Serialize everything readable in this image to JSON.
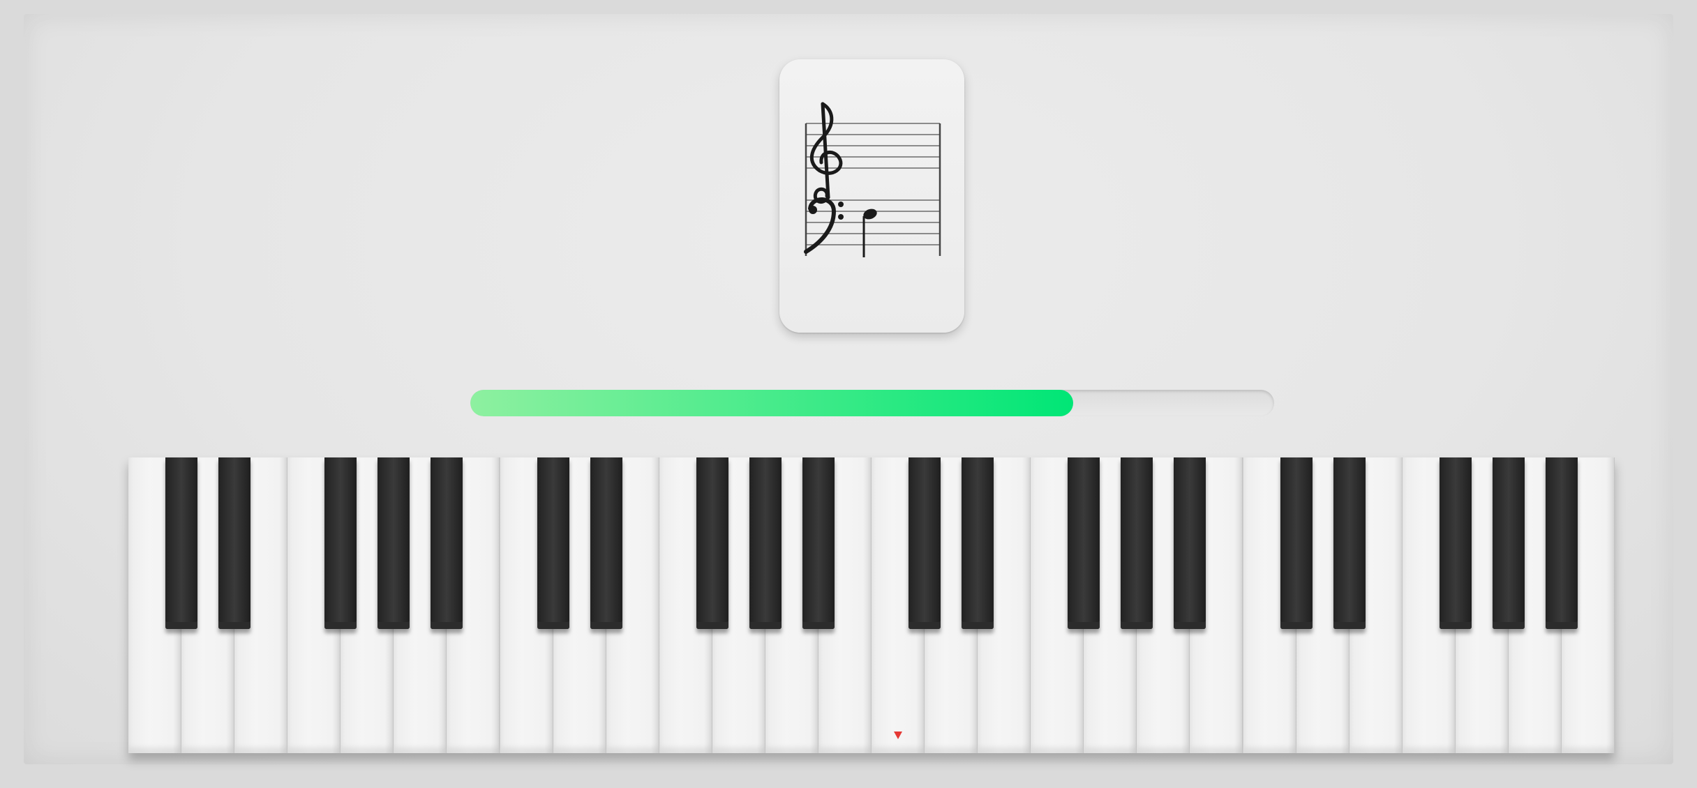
{
  "sheet_card": {
    "clefs": [
      "treble-clef-icon",
      "bass-clef-icon"
    ],
    "note": "quarter-note-icon"
  },
  "progress": {
    "value": 0.75,
    "color_start": "#8ef0a0",
    "color_end": "#00e676"
  },
  "keyboard": {
    "white_key_count": 28,
    "black_key_pattern": [
      "C#",
      "D#",
      "F#",
      "G#",
      "A#"
    ],
    "white_key_color": "#f2f2f2",
    "black_key_color": "#2a2a2a",
    "marker_color": "#e53935",
    "marker_key_index": 14
  }
}
